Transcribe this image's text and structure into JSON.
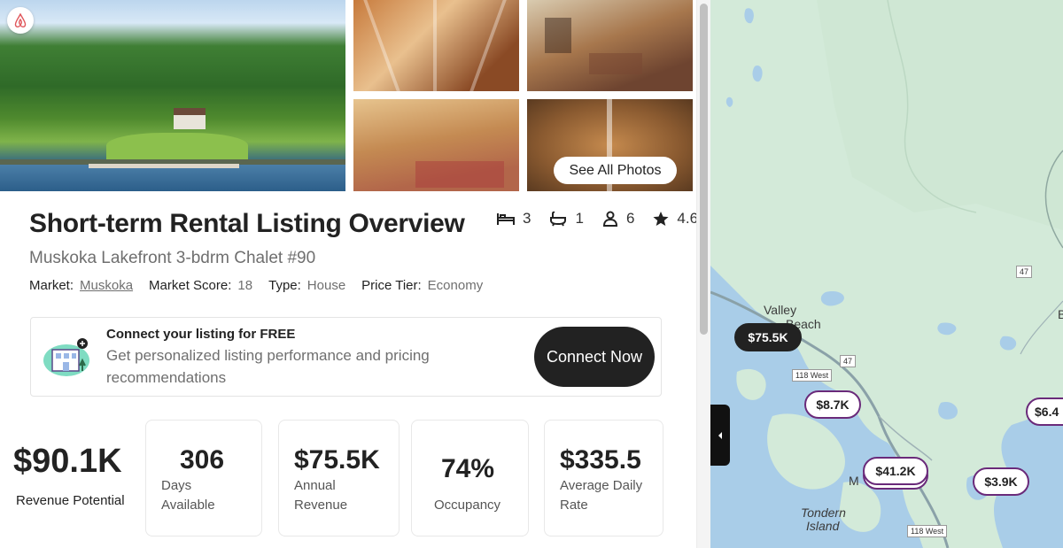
{
  "photos": {
    "see_all_label": "See All Photos"
  },
  "listing": {
    "title": "Short-term Rental Listing Overview",
    "name": "Muskoka Lakefront 3-bdrm Chalet #90",
    "bedrooms": "3",
    "bathrooms": "1",
    "guests": "6",
    "rating": "4.6",
    "meta": {
      "market_key": "Market:",
      "market_value": "Muskoka",
      "score_key": "Market Score:",
      "score_value": "18",
      "type_key": "Type:",
      "type_value": "House",
      "tier_key": "Price Tier:",
      "tier_value": "Economy"
    }
  },
  "banner": {
    "title": "Connect your listing for FREE",
    "text": "Get personalized listing performance and pricing recommendations",
    "button_label": "Connect Now"
  },
  "kpis": {
    "revenue_potential": {
      "value": "$90.1K",
      "label": "Revenue Potential"
    },
    "days_available": {
      "value": "306",
      "label": "Days Available"
    },
    "annual_revenue": {
      "value": "$75.5K",
      "label": "Annual Revenue"
    },
    "occupancy": {
      "value": "74%",
      "label": "Occupancy"
    },
    "adr": {
      "value": "$335.5",
      "label": "Average Daily Rate"
    }
  },
  "map": {
    "labels": {
      "valley": "Valley",
      "beach": "Beach",
      "tondern": "Tondern",
      "island": "Island",
      "m_partial": "M",
      "b_partial": "B"
    },
    "roads": {
      "r47a": "47",
      "r47b": "47",
      "w118a": "118 West",
      "w118b": "118 West"
    },
    "pins": [
      {
        "label": "$75.5K",
        "active": true
      },
      {
        "label": "$8.7K",
        "active": false
      },
      {
        "label": "$41.2K",
        "active": false
      },
      {
        "label": "$3.9K",
        "active": false
      },
      {
        "label": "$6.4",
        "active": false
      }
    ]
  },
  "colors": {
    "accent_dark": "#222222",
    "pin_border": "#6a2a7a",
    "map_land": "#d3ead9",
    "map_water": "#a9cde8"
  }
}
